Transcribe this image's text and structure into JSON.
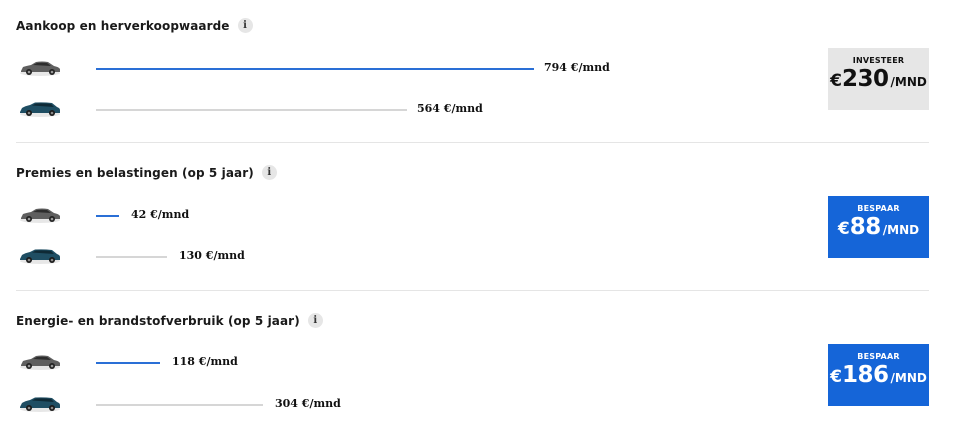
{
  "sections": [
    {
      "title": "Aankoop en herverkoopwaarde",
      "info": "i",
      "cars": [
        {
          "car": "silver-sedan-icon",
          "value": "794 €/mnd",
          "amount": 794,
          "color": "#2a6fd6"
        },
        {
          "car": "teal-wagon-icon",
          "value": "564 €/mnd",
          "amount": 564,
          "color": "#d6d6d6"
        }
      ],
      "badge": {
        "label": "INVESTEER",
        "euro": "€",
        "number": "230",
        "unit": "/MND",
        "style": "grey"
      }
    },
    {
      "title": "Premies en belastingen (op 5 jaar)",
      "info": "i",
      "cars": [
        {
          "car": "silver-sedan-icon",
          "value": "42 €/mnd",
          "amount": 42,
          "color": "#2a6fd6"
        },
        {
          "car": "teal-wagon-icon",
          "value": "130 €/mnd",
          "amount": 130,
          "color": "#d6d6d6"
        }
      ],
      "badge": {
        "label": "BESPAAR",
        "euro": "€",
        "number": "88",
        "unit": "/MND",
        "style": "blue"
      }
    },
    {
      "title": "Energie- en brandstofverbruik (op 5 jaar)",
      "info": "i",
      "cars": [
        {
          "car": "silver-sedan-icon",
          "value": "118 €/mnd",
          "amount": 118,
          "color": "#2a6fd6"
        },
        {
          "car": "teal-wagon-icon",
          "value": "304 €/mnd",
          "amount": 304,
          "color": "#d6d6d6"
        }
      ],
      "badge": {
        "label": "BESPAAR",
        "euro": "€",
        "number": "186",
        "unit": "/MND",
        "style": "blue"
      }
    }
  ],
  "colors": {
    "accent": "#1565d8",
    "bar_a": "#2a6fd6",
    "bar_b": "#d6d6d6",
    "badge_grey": "#e6e6e6"
  }
}
